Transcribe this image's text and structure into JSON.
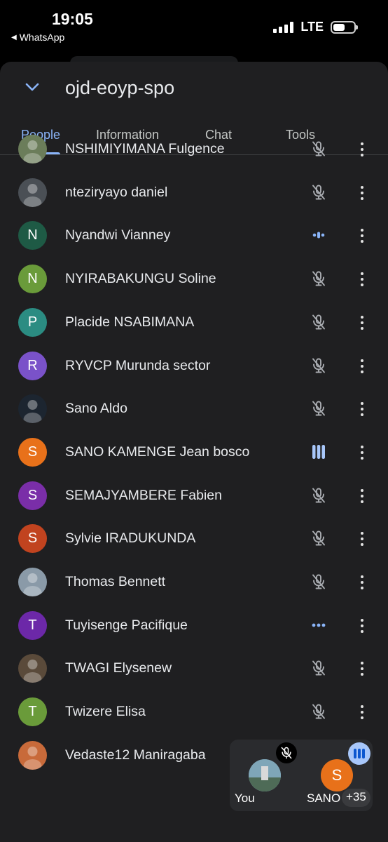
{
  "status": {
    "time": "19:05",
    "back_app": "WhatsApp",
    "network": "LTE"
  },
  "meeting": {
    "title": "ojd-eoyp-spo"
  },
  "tabs": [
    {
      "label": "People",
      "active": true
    },
    {
      "label": "Information",
      "active": false
    },
    {
      "label": "Chat",
      "active": false
    },
    {
      "label": "Tools",
      "active": false
    }
  ],
  "participants": [
    {
      "name": "NSHIMIYIMANA Fulgence",
      "initial": "",
      "color": "#6b7d5a",
      "audio": "muted"
    },
    {
      "name": "nteziryayo daniel",
      "initial": "",
      "color": "#4a4f55",
      "audio": "muted"
    },
    {
      "name": "Nyandwi Vianney",
      "initial": "N",
      "color": "#1e5a45",
      "audio": "idle-dots-small"
    },
    {
      "name": "NYIRABAKUNGU Soline",
      "initial": "N",
      "color": "#6a9b3a",
      "audio": "muted"
    },
    {
      "name": "Placide NSABIMANA",
      "initial": "P",
      "color": "#2b8c82",
      "audio": "muted"
    },
    {
      "name": "RYVCP Murunda sector",
      "initial": "R",
      "color": "#7a52c9",
      "audio": "muted"
    },
    {
      "name": "Sano Aldo",
      "initial": "",
      "color": "#1c2530",
      "audio": "muted"
    },
    {
      "name": "SANO KAMENGE Jean bosco",
      "initial": "S",
      "color": "#e8711a",
      "audio": "speaking"
    },
    {
      "name": "SEMAJYAMBERE Fabien",
      "initial": "S",
      "color": "#7a2ea8",
      "audio": "muted"
    },
    {
      "name": "Sylvie IRADUKUNDA",
      "initial": "S",
      "color": "#c1431f",
      "audio": "muted"
    },
    {
      "name": "Thomas Bennett",
      "initial": "",
      "color": "#8a9aa8",
      "audio": "muted"
    },
    {
      "name": "Tuyisenge Pacifique",
      "initial": "T",
      "color": "#6c28a8",
      "audio": "idle-dots"
    },
    {
      "name": "TWAGI Elysenew",
      "initial": "",
      "color": "#5a4a3a",
      "audio": "muted"
    },
    {
      "name": "Twizere Elisa",
      "initial": "T",
      "color": "#6a9b3a",
      "audio": "muted"
    },
    {
      "name": "Vedaste12 Maniragaba",
      "initial": "",
      "color": "#c86a3a",
      "audio": "none"
    }
  ],
  "pip": {
    "you_label": "You",
    "other_label": "SANO",
    "other_initial": "S",
    "count": "+35"
  },
  "colors": {
    "accent": "#8ab4f8",
    "sheet_bg": "#1f1f21",
    "speaking_bg": "#a8c7fa"
  },
  "icons": {
    "header": "chevron-down-icon",
    "muted": "mic-off-icon",
    "more": "more-vert-icon",
    "speaking": "audio-level-icon"
  }
}
